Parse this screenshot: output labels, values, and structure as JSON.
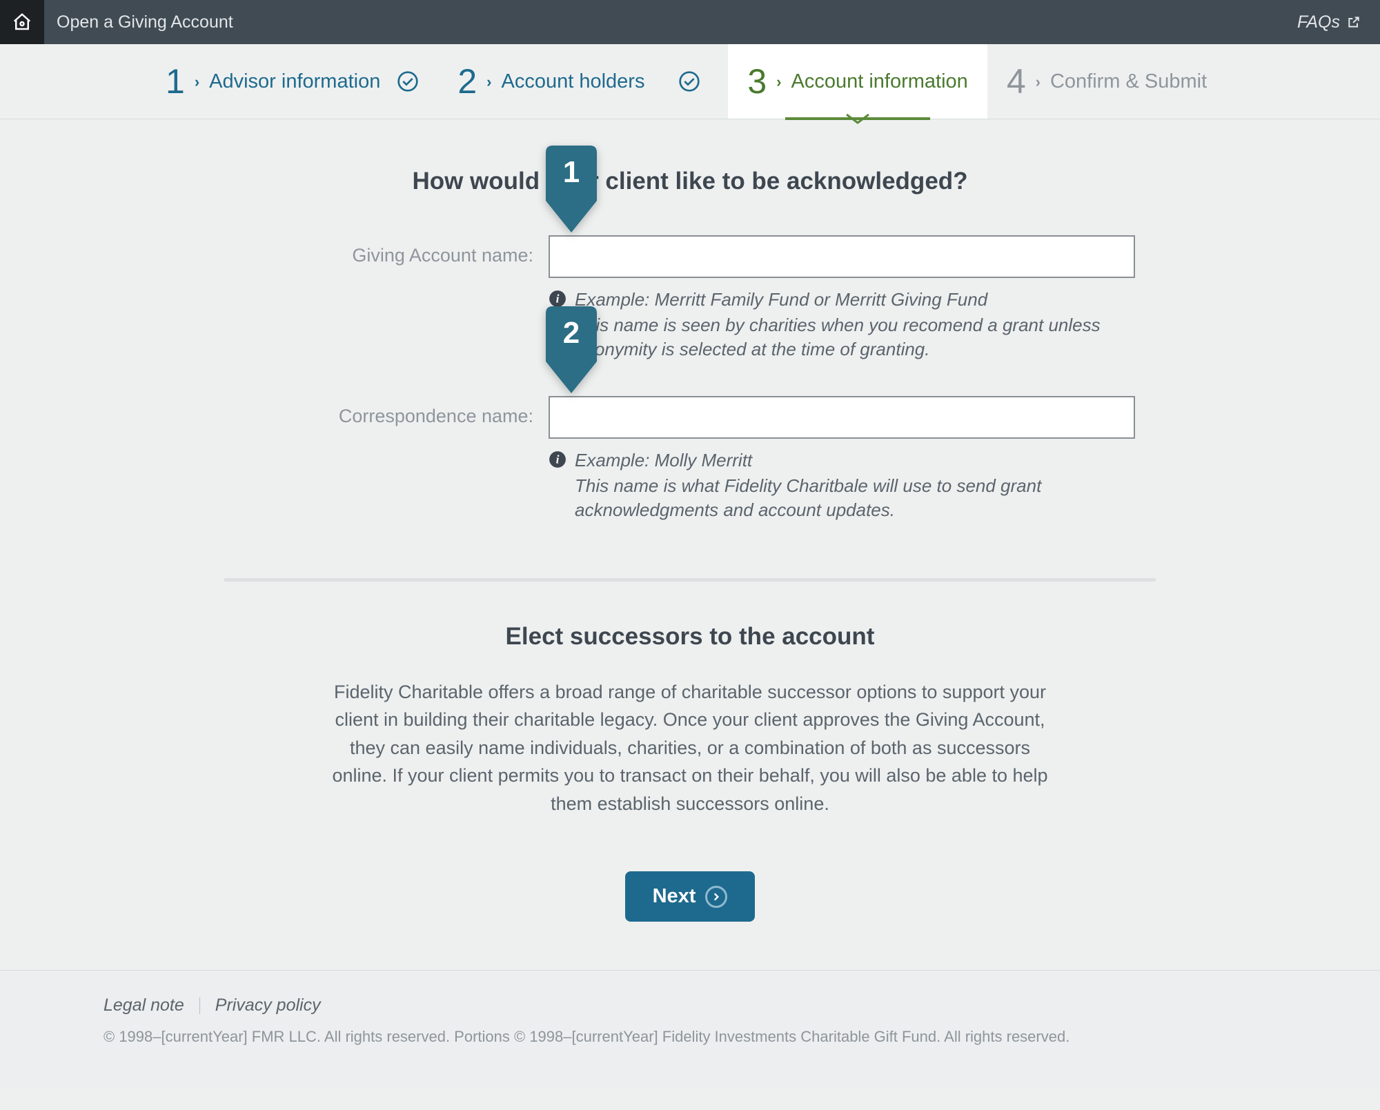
{
  "topbar": {
    "title": "Open a Giving Account",
    "faqs_label": "FAQs"
  },
  "stepper": {
    "steps": [
      {
        "num": "1",
        "label": "Advisor information",
        "state": "done"
      },
      {
        "num": "2",
        "label": "Account holders",
        "state": "done"
      },
      {
        "num": "3",
        "label": "Account information",
        "state": "active"
      },
      {
        "num": "4",
        "label": "Confirm & Submit",
        "state": "upcoming"
      }
    ]
  },
  "section1": {
    "title": "How would your client like to be acknowledged?",
    "giving_account_label": "Giving Account name:",
    "giving_account_value": "",
    "giving_example": "Example: Merritt Family Fund or Merritt Giving Fund",
    "giving_desc": "This name is seen by charities when you recomend a grant unless anonymity is selected at the time of granting.",
    "correspondence_label": "Correspondence name:",
    "correspondence_value": "",
    "correspondence_example": "Example: Molly Merritt",
    "correspondence_desc": "This name is what Fidelity Charitbale will use to send grant acknowledgments and account updates."
  },
  "markers": {
    "m1": "1",
    "m2": "2"
  },
  "section2": {
    "title": "Elect successors to the account",
    "body": "Fidelity Charitable offers a broad range of charitable successor options to support your client in building their charitable legacy. Once your client approves the Giving Account, they can easily name individuals, charities, or a combination of both as successors online. If your client permits you to transact on their behalf, you will also be able to help them establish successors online."
  },
  "actions": {
    "next_label": "Next"
  },
  "footer": {
    "legal_label": "Legal note",
    "privacy_label": "Privacy policy",
    "copyright": "© 1998–[currentYear] FMR LLC. All rights reserved. Portions © 1998–[currentYear] Fidelity Investments Charitable Gift Fund. All rights reserved."
  }
}
